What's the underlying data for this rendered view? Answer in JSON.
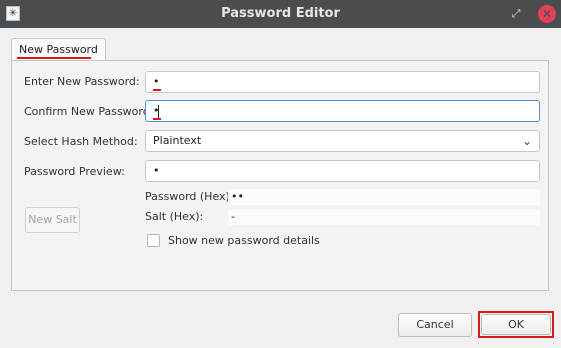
{
  "window": {
    "title": "Password Editor"
  },
  "tabs": [
    {
      "label": "New Password"
    }
  ],
  "form": {
    "enter_label": "Enter New Password:",
    "enter_value": "•",
    "confirm_label": "Confirm New Password:",
    "confirm_value": "•",
    "hash_label": "Select Hash Method:",
    "hash_value": "Plaintext",
    "preview_label": "Password Preview:",
    "preview_value": "•",
    "password_hex_label": "Password (Hex):",
    "password_hex_value": "••",
    "salt_hex_label": "Salt (Hex):",
    "salt_hex_value": "-",
    "new_salt_label": "New Salt",
    "show_details_label": "Show new password details"
  },
  "footer": {
    "cancel_label": "Cancel",
    "ok_label": "OK"
  },
  "icons": {
    "app": "app-icon",
    "restore": "restore-icon",
    "close": "close-icon",
    "dropdown": "chevron-down-icon"
  },
  "colors": {
    "accent_red": "#d61a1a",
    "focus_blue": "#4d8fd1",
    "titlebar": "#4a4d50"
  }
}
